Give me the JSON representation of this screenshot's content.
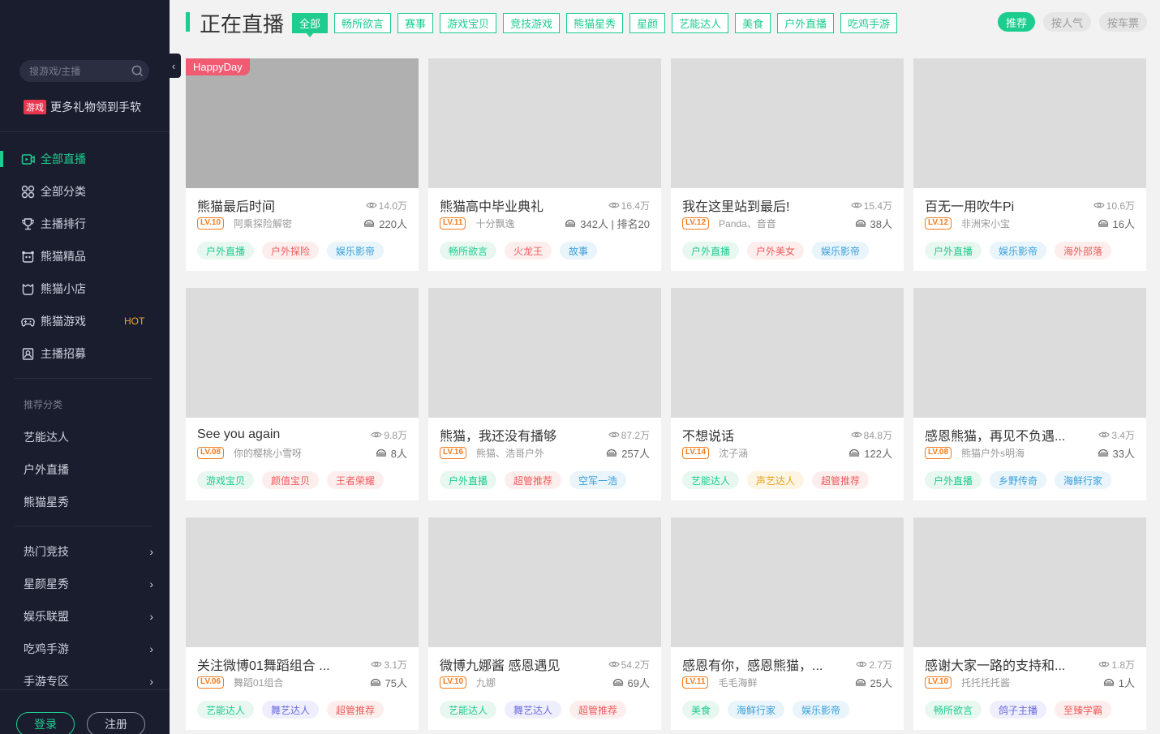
{
  "sidebar": {
    "search_placeholder": "搜游戏/主播",
    "promo_badge": "游戏",
    "promo_text": "更多礼物领到手软",
    "nav": [
      {
        "label": "全部直播",
        "icon": "live-icon",
        "active": true
      },
      {
        "label": "全部分类",
        "icon": "category-icon"
      },
      {
        "label": "主播排行",
        "icon": "trophy-icon"
      },
      {
        "label": "熊猫精品",
        "icon": "panda-icon"
      },
      {
        "label": "熊猫小店",
        "icon": "shop-icon"
      },
      {
        "label": "熊猫游戏",
        "icon": "gamepad-icon",
        "hot": "HOT"
      },
      {
        "label": "主播招募",
        "icon": "recruit-icon"
      }
    ],
    "rec_title": "推荐分类",
    "rec_items": [
      "艺能达人",
      "户外直播",
      "熊猫星秀"
    ],
    "groups": [
      "热门竞技",
      "星颜星秀",
      "娱乐联盟",
      "吃鸡手游",
      "手游专区"
    ],
    "login_label": "登录",
    "register_label": "注册"
  },
  "header": {
    "title": "正在直播",
    "tabs": [
      "全部",
      "畅所欲言",
      "赛事",
      "游戏宝贝",
      "竞技游戏",
      "熊猫星秀",
      "星颜",
      "艺能达人",
      "美食",
      "户外直播",
      "吃鸡手游"
    ],
    "sort": [
      "推荐",
      "按人气",
      "按车票"
    ]
  },
  "colors": {
    "accent": "#1ccd8e",
    "sidebar_bg": "#1a1d2e",
    "level": "#f37b1d",
    "badge": "#f05b72"
  },
  "cards": [
    {
      "title": "熊猫最后时间",
      "views": "14.0万",
      "level": "LV.10",
      "host": "阿乘探险解密",
      "fans": "220人",
      "badge": "HappyDay",
      "dark": true,
      "tags": [
        {
          "t": "户外直播",
          "c": "tg"
        },
        {
          "t": "户外探险",
          "c": "tr"
        },
        {
          "t": "娱乐影帝",
          "c": "tb"
        }
      ]
    },
    {
      "title": "熊猫高中毕业典礼",
      "views": "16.4万",
      "level": "LV.11",
      "host": "十分飘逸",
      "fans": "342人 | 排名20",
      "tags": [
        {
          "t": "畅所欲言",
          "c": "tg"
        },
        {
          "t": "火龙王",
          "c": "tr"
        },
        {
          "t": "故事",
          "c": "tb"
        }
      ]
    },
    {
      "title": "我在这里站到最后!",
      "views": "15.4万",
      "level": "LV.12",
      "host": "Panda、音音",
      "fans": "38人",
      "tags": [
        {
          "t": "户外直播",
          "c": "tg"
        },
        {
          "t": "户外美女",
          "c": "tr"
        },
        {
          "t": "娱乐影帝",
          "c": "tb"
        }
      ]
    },
    {
      "title": "百无一用吹牛Pi",
      "views": "10.6万",
      "level": "LV.12",
      "host": "非洲宋小宝",
      "fans": "16人",
      "tags": [
        {
          "t": "户外直播",
          "c": "tg"
        },
        {
          "t": "娱乐影帝",
          "c": "tb"
        },
        {
          "t": "海外部落",
          "c": "tr"
        }
      ]
    },
    {
      "title": "See you again",
      "views": "9.8万",
      "level": "LV.08",
      "host": "你的樱桃小雪呀",
      "fans": "8人",
      "tags": [
        {
          "t": "游戏宝贝",
          "c": "tg"
        },
        {
          "t": "颜值宝贝",
          "c": "tr"
        },
        {
          "t": "王者荣耀",
          "c": "tr"
        }
      ]
    },
    {
      "title": "熊猫，我还没有播够",
      "views": "87.2万",
      "level": "LV.16",
      "host": "熊猫、浩哥户外",
      "fans": "257人",
      "tags": [
        {
          "t": "户外直播",
          "c": "tg"
        },
        {
          "t": "超管推荐",
          "c": "tr"
        },
        {
          "t": "空军一浩",
          "c": "tb"
        }
      ]
    },
    {
      "title": "不想说话",
      "views": "84.8万",
      "level": "LV.14",
      "host": "沈子涵",
      "fans": "122人",
      "tags": [
        {
          "t": "艺能达人",
          "c": "tg"
        },
        {
          "t": "声艺达人",
          "c": "ty"
        },
        {
          "t": "超管推荐",
          "c": "tr"
        }
      ]
    },
    {
      "title": "感恩熊猫，再见不负遇...",
      "views": "3.4万",
      "level": "LV.08",
      "host": "熊猫户外s明海",
      "fans": "33人",
      "tags": [
        {
          "t": "户外直播",
          "c": "tg"
        },
        {
          "t": "乡野传奇",
          "c": "tb"
        },
        {
          "t": "海鲜行家",
          "c": "tb"
        }
      ]
    },
    {
      "title": "关注微博01舞蹈组合 ...",
      "views": "3.1万",
      "level": "LV.06",
      "host": "舞蹈01组合",
      "fans": "75人",
      "tags": [
        {
          "t": "艺能达人",
          "c": "tg"
        },
        {
          "t": "舞艺达人",
          "c": "tp"
        },
        {
          "t": "超管推荐",
          "c": "tr"
        }
      ]
    },
    {
      "title": "微博九娜酱 感恩遇见",
      "views": "54.2万",
      "level": "LV.10",
      "host": "九娜",
      "fans": "69人",
      "tags": [
        {
          "t": "艺能达人",
          "c": "tg"
        },
        {
          "t": "舞艺达人",
          "c": "tp"
        },
        {
          "t": "超管推荐",
          "c": "tr"
        }
      ]
    },
    {
      "title": "感恩有你，感恩熊猫，...",
      "views": "2.7万",
      "level": "LV.11",
      "host": "毛毛海鲜",
      "fans": "25人",
      "tags": [
        {
          "t": "美食",
          "c": "tg"
        },
        {
          "t": "海鲜行家",
          "c": "tb"
        },
        {
          "t": "娱乐影帝",
          "c": "tb"
        }
      ]
    },
    {
      "title": "感谢大家一路的支持和...",
      "views": "1.8万",
      "level": "LV.10",
      "host": "托托托托酱",
      "fans": "1人",
      "tags": [
        {
          "t": "畅所欲言",
          "c": "tg"
        },
        {
          "t": "鸽子主播",
          "c": "tp"
        },
        {
          "t": "至臻学霸",
          "c": "tr"
        }
      ]
    }
  ]
}
